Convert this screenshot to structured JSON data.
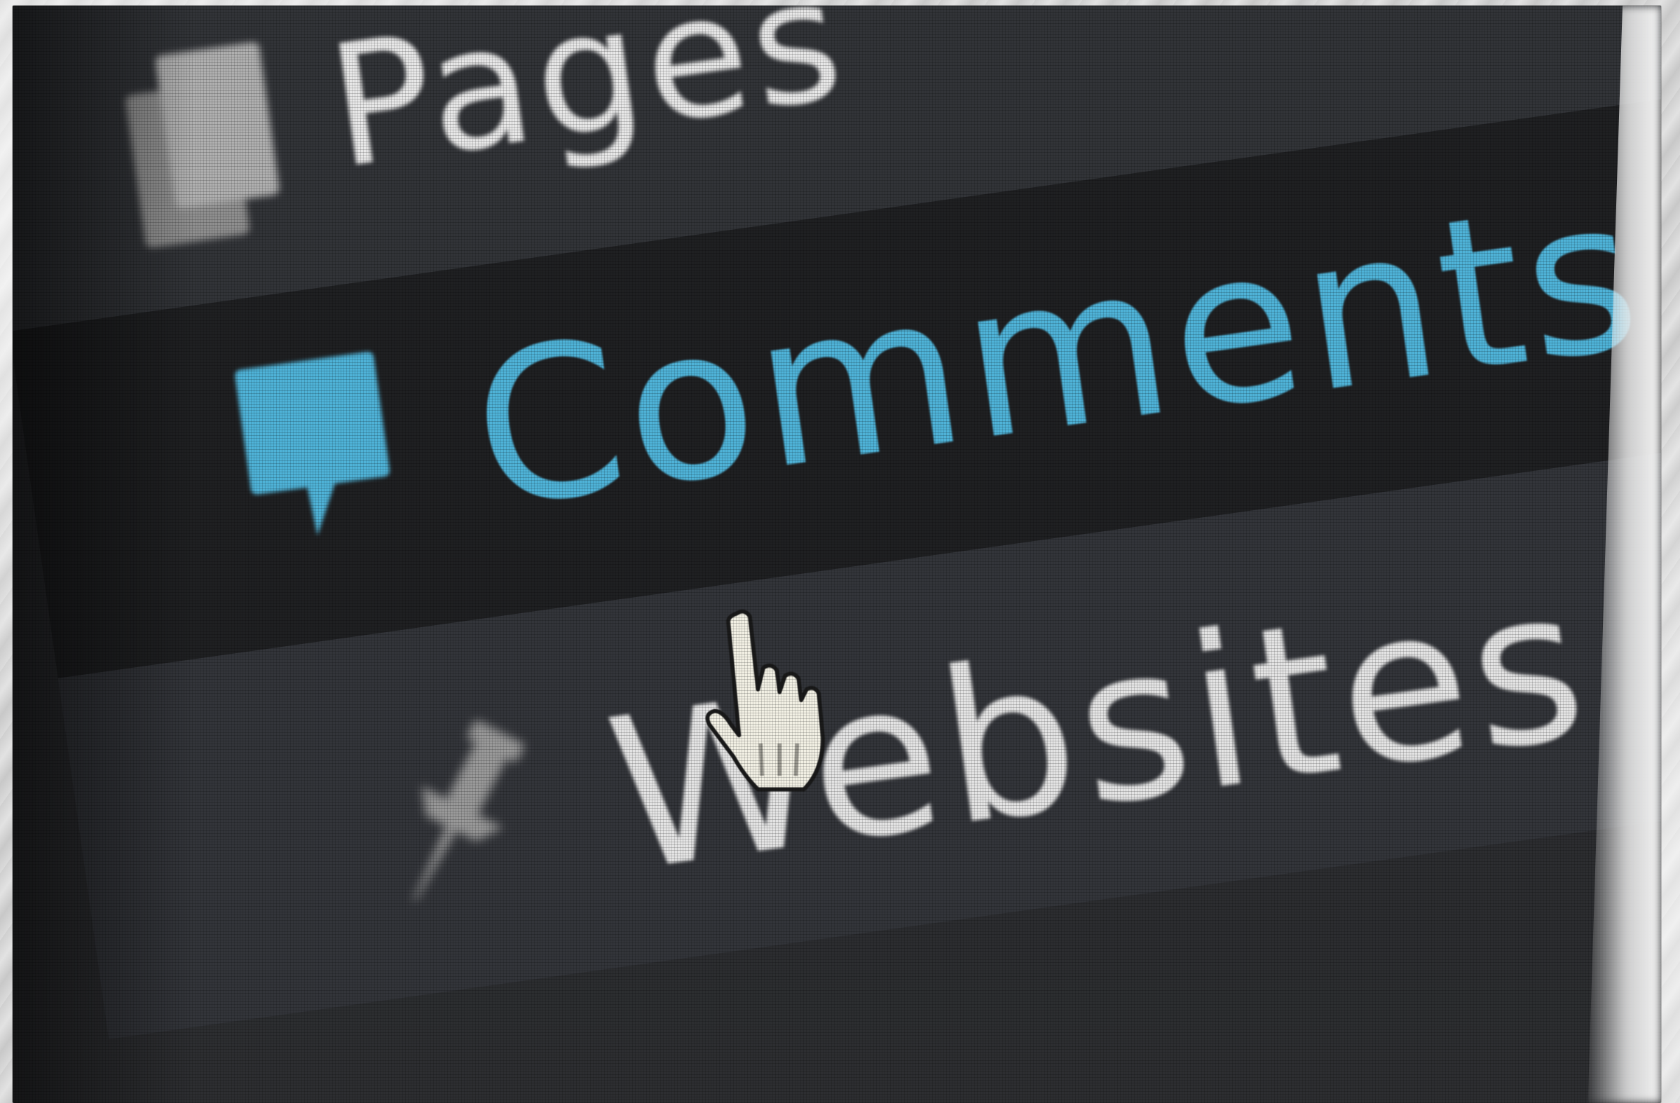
{
  "menu": {
    "items": [
      {
        "label": "Pages",
        "icon": "pages-icon",
        "state": "default"
      },
      {
        "label": "Comments",
        "icon": "comment-bubble-icon",
        "state": "hover"
      },
      {
        "label": "Websites",
        "icon": "pushpin-icon",
        "state": "default"
      }
    ]
  },
  "cursor": {
    "icon": "hand-pointer-icon"
  },
  "colors": {
    "menu_background": "#2d2e31",
    "hover_background": "#1f2022",
    "accent": "#4fb3d8",
    "text": "#e6e6e6",
    "icon_default": "#a5a5a5"
  }
}
